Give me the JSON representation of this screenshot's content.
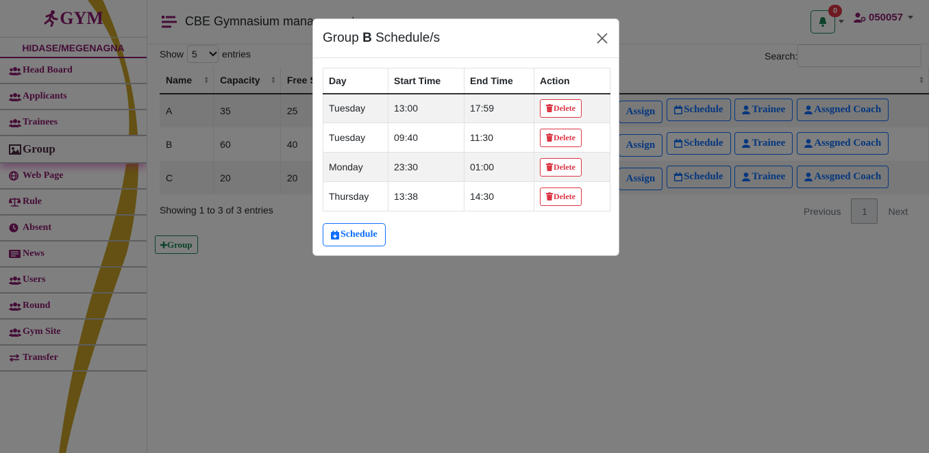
{
  "app": {
    "logo_text": "GYM",
    "branch": "HIDASE/MEGENAGNA",
    "title": "CBE Gymnasium management"
  },
  "sidebar": {
    "items": [
      {
        "label": "Head Board",
        "icon": "users-icon"
      },
      {
        "label": "Applicants",
        "icon": "users-icon"
      },
      {
        "label": "Trainees",
        "icon": "users-icon"
      },
      {
        "label": "Group",
        "icon": "group-icon",
        "active": true
      },
      {
        "label": "Web Page",
        "icon": "globe-icon"
      },
      {
        "label": "Rule",
        "icon": "scale-icon"
      },
      {
        "label": "Absent",
        "icon": "clock-icon"
      },
      {
        "label": "News",
        "icon": "newspaper-icon"
      },
      {
        "label": "Users",
        "icon": "users-icon"
      },
      {
        "label": "Round",
        "icon": "users-icon"
      },
      {
        "label": "Gym Site",
        "icon": "users-icon"
      },
      {
        "label": "Transfer",
        "icon": "transfer-icon"
      }
    ]
  },
  "header": {
    "notification_count": "0",
    "user_id": "050057"
  },
  "datatable": {
    "show_label": "Show",
    "entries_value": "5",
    "entries_label": "entries",
    "search_label": "Search:",
    "search_value": "",
    "columns": [
      "Name",
      "Capacity",
      "Free S"
    ],
    "rows": [
      {
        "name": "A",
        "capacity": "35",
        "free": "25"
      },
      {
        "name": "B",
        "capacity": "60",
        "free": "40"
      },
      {
        "name": "C",
        "capacity": "20",
        "free": "20"
      }
    ],
    "row_actions": {
      "assign": "Assign",
      "schedule": "Schedule",
      "trainee": "Trainee",
      "coach": "Assgned Coach"
    },
    "info": "Showing 1 to 3 of 3 entries",
    "pagination": {
      "previous": "Previous",
      "current": "1",
      "next": "Next"
    },
    "add_group": "Group"
  },
  "modal": {
    "title_prefix": "Group",
    "group_name": "B",
    "title_suffix": "Schedule/s",
    "columns": [
      "Day",
      "Start Time",
      "End Time",
      "Action"
    ],
    "rows": [
      {
        "day": "Tuesday",
        "start": "13:00",
        "end": "17:59",
        "action": "Delete"
      },
      {
        "day": "Tuesday",
        "start": "09:40",
        "end": "11:30",
        "action": "Delete"
      },
      {
        "day": "Monday",
        "start": "23:30",
        "end": "01:00",
        "action": "Delete"
      },
      {
        "day": "Thursday",
        "start": "13:38",
        "end": "14:30",
        "action": "Delete"
      }
    ],
    "schedule_button": "Schedule"
  },
  "colors": {
    "brand": "#8b1a6e",
    "primary": "#0d6efd",
    "danger": "#dc3545",
    "success": "#198754",
    "swoosh": "#c9a227"
  }
}
